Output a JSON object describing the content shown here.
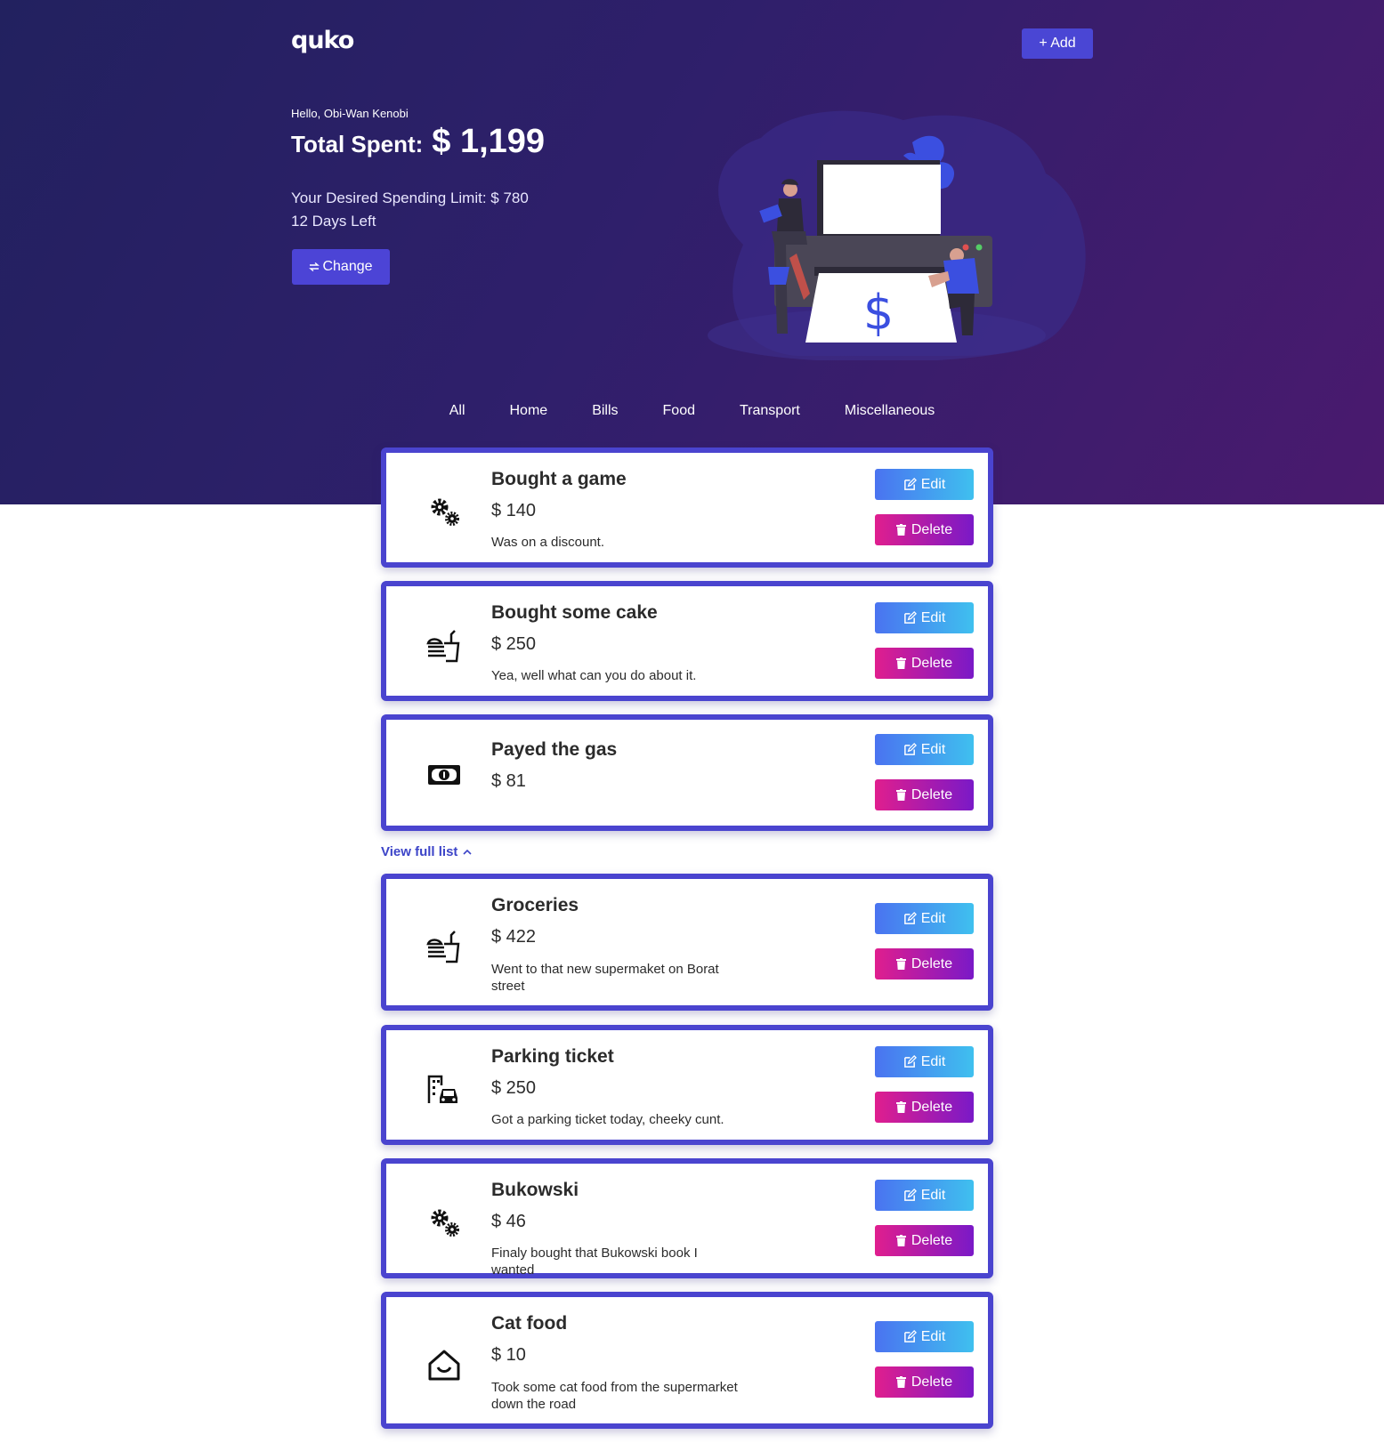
{
  "app": {
    "logo": "quko",
    "add_label": "+ Add"
  },
  "summary": {
    "greeting": "Hello, Obi-Wan Kenobi",
    "total_label": "Total Spent:",
    "total_value": "$ 1,199",
    "limit_text": "Your Desired Spending Limit: $ 780",
    "days_left": "12 Days Left",
    "change_label": "Change",
    "illustration_symbol": "$"
  },
  "tabs": [
    "All",
    "Home",
    "Bills",
    "Food",
    "Transport",
    "Miscellaneous"
  ],
  "buttons": {
    "edit": "Edit",
    "delete": "Delete"
  },
  "view_full_list": "View full list",
  "expenses": [
    {
      "title": "Bought a game",
      "amount": "$ 140",
      "description": "Was on a discount.",
      "icon": "gears-icon"
    },
    {
      "title": "Bought some cake",
      "amount": "$ 250",
      "description": "Yea, well what can you do about it.",
      "icon": "food-icon"
    },
    {
      "title": "Payed the gas",
      "amount": "$ 81",
      "description": "",
      "icon": "money-bill-icon"
    },
    {
      "title": "Groceries",
      "amount": "$ 422",
      "description": "Went to that new supermaket on Borat street",
      "icon": "food-icon"
    },
    {
      "title": "Parking ticket",
      "amount": "$ 250",
      "description": "Got a parking ticket today, cheeky cunt.",
      "icon": "car-building-icon"
    },
    {
      "title": "Bukowski",
      "amount": "$ 46",
      "description": "Finaly bought that Bukowski book I wanted",
      "icon": "gears-icon"
    },
    {
      "title": "Cat food",
      "amount": "$ 10",
      "description": "Took some cat food from the supermarket down the road",
      "icon": "home-icon"
    }
  ],
  "colors": {
    "hero_start": "#22215f",
    "hero_end": "#4a1a6e",
    "accent": "#4a44cf",
    "edit": "#4a73f0",
    "delete": "#e01e8e"
  }
}
